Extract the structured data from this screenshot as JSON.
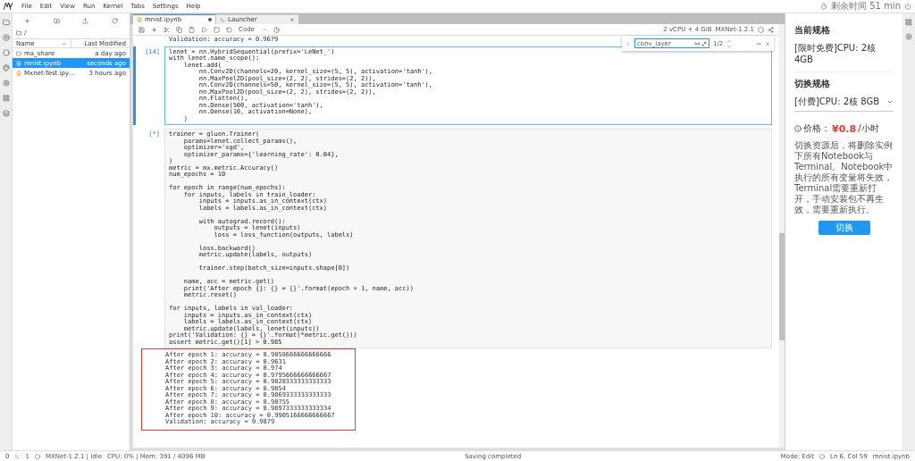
{
  "menu": {
    "items": [
      "File",
      "Edit",
      "View",
      "Run",
      "Kernel",
      "Tabs",
      "Settings",
      "Help"
    ],
    "session_timer": "剩余时间 51 min"
  },
  "file_browser": {
    "path": "/",
    "columns": [
      "Name",
      "Last Modified"
    ],
    "items": [
      {
        "kind": "folder",
        "name": "ma_share",
        "modified": "a day ago",
        "selected": false
      },
      {
        "kind": "notebook",
        "name": "mnist.ipynb",
        "modified": "seconds ago",
        "selected": true
      },
      {
        "kind": "notebook",
        "name": "Mxnet-Test.ipy...",
        "modified": "3 hours ago",
        "selected": false
      }
    ]
  },
  "tabs": [
    {
      "label": "mnist.ipynb",
      "selected": true,
      "unsaved": true
    },
    {
      "label": "Launcher",
      "selected": false,
      "unsaved": false
    }
  ],
  "toolbar": {
    "cell_type": "Code",
    "resources": "2 vCPU + 4 GiB",
    "kernel": "MXNet-1.2.1"
  },
  "search": {
    "value": "conv_layer",
    "count": "1/2"
  },
  "previous_output": "Validation: accuracy = 0.9679",
  "cells": [
    {
      "prompt": "[14]",
      "active": true,
      "code": "lenet = nn.HybridSequential(prefix='LeNet_')\nwith lenet.name_scope():\n    lenet.add(\n        nn.Conv2D(channels=20, kernel_size=(5, 5), activation='tanh'),\n        nn.MaxPool2D(pool_size=(2, 2), strides=(2, 2)),\n        nn.Conv2D(channels=50, kernel_size=(5, 5), activation='tanh'),\n        nn.MaxPool2D(pool_size=(2, 2), strides=(2, 2)),\n        nn.Flatten(),\n        nn.Dense(500, activation='tanh'),\n        nn.Dense(10, activation=None),\n    )"
    },
    {
      "prompt": "[*]",
      "active": false,
      "highlighted": true,
      "code": "trainer = gluon.Trainer(\n    params=lenet.collect_params(),\n    optimizer='sgd',\n    optimizer_params={'learning_rate': 0.04},\n)\nmetric = mx.metric.Accuracy()\nnum_epochs = 10\n\nfor epoch in range(num_epochs):\n    for inputs, labels in train_loader:\n        inputs = inputs.as_in_context(ctx)\n        labels = labels.as_in_context(ctx)\n\n        with autograd.record():\n            outputs = lenet(inputs)\n            loss = loss_function(outputs, labels)\n\n        loss.backward()\n        metric.update(labels, outputs)\n\n        trainer.step(batch_size=inputs.shape[0])\n\n    name, acc = metric.get()\n    print('After epoch {}: {} = {}'.format(epoch + 1, name, acc))\n    metric.reset()\n\nfor inputs, labels in val_loader:\n    inputs = inputs.as_in_context(ctx)\n    labels = labels.as_in_context(ctx)\n    metric.update(labels, lenet(inputs))\nprint('Validation: {} = {}'.format(*metric.get()))\nassert metric.get()[1] > 0.985",
      "output": [
        "After epoch 1: accuracy = 0.9058666666666666",
        "After epoch 2: accuracy = 0.9631",
        "After epoch 3: accuracy = 0.974",
        "After epoch 4: accuracy = 0.9795666666666667",
        "After epoch 5: accuracy = 0.9828333333333333",
        "After epoch 6: accuracy = 0.9854",
        "After epoch 7: accuracy = 0.9869333333333333",
        "After epoch 8: accuracy = 0.98755",
        "After epoch 9: accuracy = 0.9897333333333334",
        "After epoch 10: accuracy = 0.9905166666666667",
        "Validation: accuracy = 0.9879"
      ]
    }
  ],
  "right_panel": {
    "current_title": "当前规格",
    "current_spec": "[限时免费]CPU: 2核 4GB",
    "switch_title": "切换规格",
    "switch_select": "[付费]CPU: 2核 8GB",
    "price_label": "价格：",
    "price": "¥0.8",
    "price_unit": "/小时",
    "note": "切换资源后，将删除实例下所有Notebook与Terminal。Notebook中执行的所有变量将失效，Terminal需要重新打开，手动安装包不再生效，需要重新执行。",
    "button": "切换"
  },
  "status_bar": {
    "terminals": "0",
    "kernels": "1",
    "kernel_status": "MXNet-1.2.1 | Idle",
    "resources": "CPU: 0% | Mem: 391 / 4096 MB",
    "message": "Saving completed",
    "mode": "Mode: Edit",
    "cursor": "Ln 6, Col 59",
    "file": "mnist.ipynb"
  }
}
